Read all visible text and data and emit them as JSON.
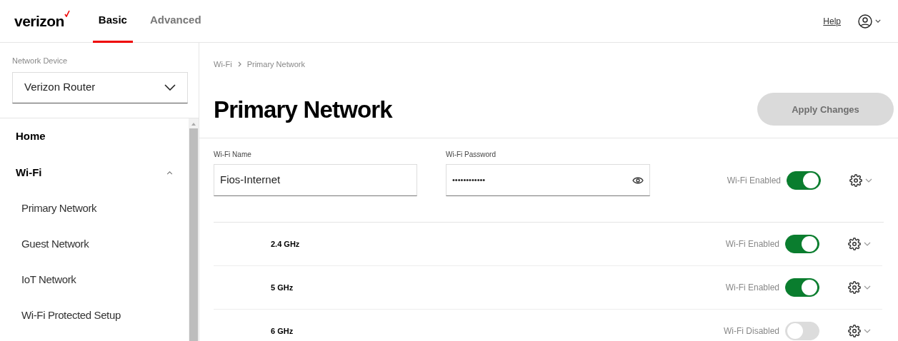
{
  "header": {
    "logo": "verizon",
    "tabs": [
      {
        "label": "Basic",
        "selected": true
      },
      {
        "label": "Advanced",
        "selected": false
      }
    ],
    "help": "Help"
  },
  "sidebar": {
    "device_label": "Network Device",
    "device": "Verizon Router",
    "nav": [
      {
        "label": "Home"
      },
      {
        "label": "Wi-Fi",
        "expanded": true,
        "children": [
          {
            "label": "Primary Network"
          },
          {
            "label": "Guest Network"
          },
          {
            "label": "IoT Network"
          },
          {
            "label": "Wi-Fi Protected Setup"
          }
        ]
      }
    ]
  },
  "main": {
    "breadcrumb": [
      "Wi-Fi",
      "Primary Network"
    ],
    "title": "Primary Network",
    "apply_button": {
      "label": "Apply Changes",
      "disabled": true
    },
    "name_label": "Wi-Fi Name",
    "name_value": "Fios-Internet",
    "password_label": "Wi-Fi Password",
    "password_value": "••••••••••••",
    "status": {
      "label": "Wi-Fi Enabled",
      "on": true
    },
    "bands": [
      {
        "name": "2.4 GHz",
        "label": "Wi-Fi Enabled",
        "on": true
      },
      {
        "name": "5 GHz",
        "label": "Wi-Fi Enabled",
        "on": true
      },
      {
        "name": "6 GHz",
        "label": "Wi-Fi Disabled",
        "on": false
      }
    ]
  }
}
